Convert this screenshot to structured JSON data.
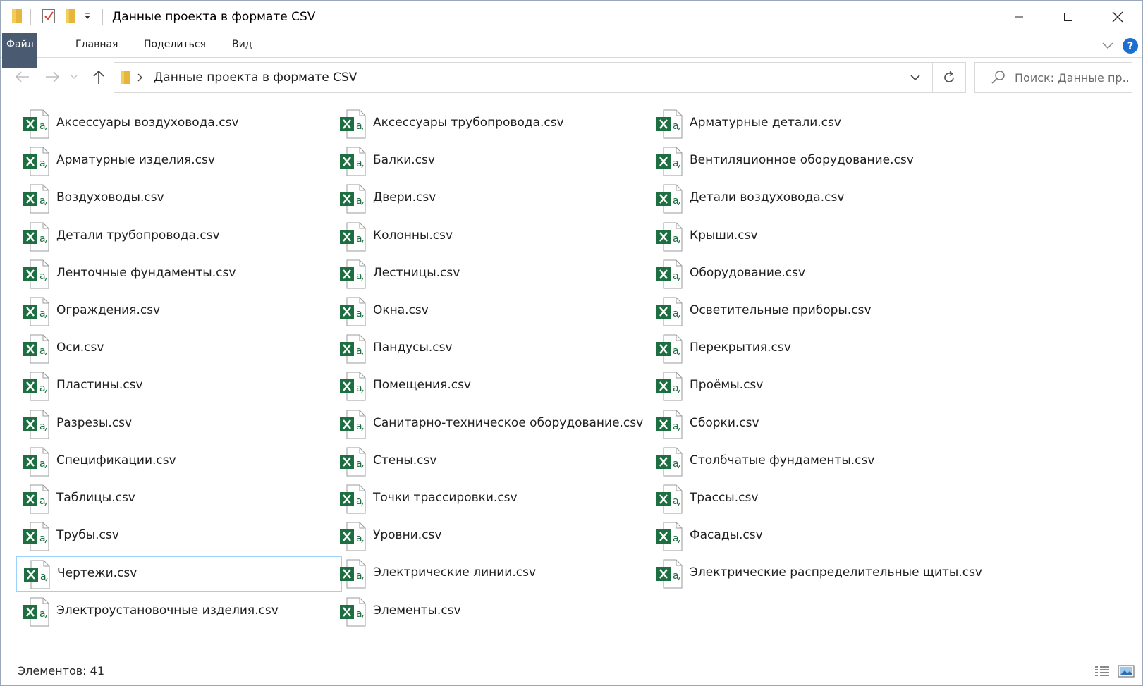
{
  "window": {
    "title": "Данные проекта в формате CSV"
  },
  "ribbon": {
    "tabs": [
      {
        "label": "Файл"
      },
      {
        "label": "Главная"
      },
      {
        "label": "Поделиться"
      },
      {
        "label": "Вид"
      }
    ],
    "help_label": "?"
  },
  "address": {
    "breadcrumb": "Данные проекта в формате CSV",
    "search_placeholder": "Поиск: Данные пр..."
  },
  "icons": {
    "file_icon": "excel-csv-icon",
    "accent": "#1d6f42",
    "selection_border": "#99d1ff",
    "file_tab_bg": "#4a5a70"
  },
  "files": [
    {
      "name": "Аксессуары воздуховода.csv"
    },
    {
      "name": "Аксессуары трубопровода.csv"
    },
    {
      "name": "Арматурные детали.csv"
    },
    {
      "name": "Арматурные изделия.csv"
    },
    {
      "name": "Балки.csv"
    },
    {
      "name": "Вентиляционное оборудование.csv"
    },
    {
      "name": "Воздуховоды.csv"
    },
    {
      "name": "Двери.csv"
    },
    {
      "name": "Детали воздуховода.csv"
    },
    {
      "name": "Детали трубопровода.csv"
    },
    {
      "name": "Колонны.csv"
    },
    {
      "name": "Крыши.csv"
    },
    {
      "name": "Ленточные фундаменты.csv"
    },
    {
      "name": "Лестницы.csv"
    },
    {
      "name": "Оборудование.csv"
    },
    {
      "name": "Ограждения.csv"
    },
    {
      "name": "Окна.csv"
    },
    {
      "name": "Осветительные приборы.csv"
    },
    {
      "name": "Оси.csv"
    },
    {
      "name": "Пандусы.csv"
    },
    {
      "name": "Перекрытия.csv"
    },
    {
      "name": "Пластины.csv"
    },
    {
      "name": "Помещения.csv"
    },
    {
      "name": "Проёмы.csv"
    },
    {
      "name": "Разрезы.csv"
    },
    {
      "name": "Санитарно-техническое оборудование.csv"
    },
    {
      "name": "Сборки.csv"
    },
    {
      "name": "Спецификации.csv"
    },
    {
      "name": "Стены.csv"
    },
    {
      "name": "Столбчатые фундаменты.csv"
    },
    {
      "name": "Таблицы.csv"
    },
    {
      "name": "Точки трассировки.csv"
    },
    {
      "name": "Трассы.csv"
    },
    {
      "name": "Трубы.csv"
    },
    {
      "name": "Уровни.csv"
    },
    {
      "name": "Фасады.csv"
    },
    {
      "name": "Чертежи.csv",
      "selected": true
    },
    {
      "name": "Электрические линии.csv"
    },
    {
      "name": "Электрические распределительные щиты.csv"
    },
    {
      "name": "Электроустановочные изделия.csv"
    },
    {
      "name": "Элементы.csv"
    }
  ],
  "status": {
    "text": "Элементов: 41"
  }
}
